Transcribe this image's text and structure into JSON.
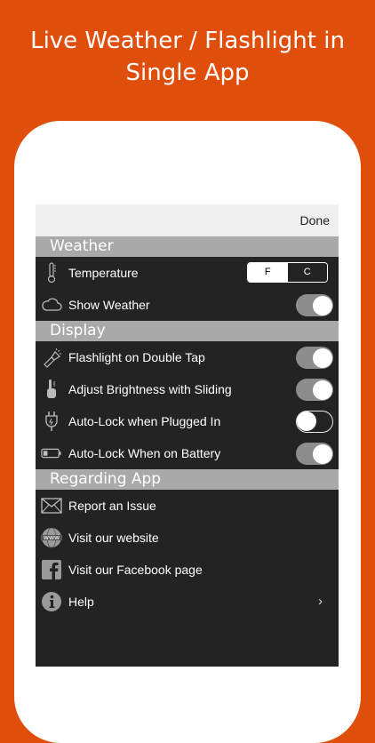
{
  "headline": {
    "line1": "Live Weather / Flashlight in",
    "line2": "Single App"
  },
  "navbar": {
    "done_label": "Done"
  },
  "sections": {
    "weather": {
      "title": "Weather",
      "temperature_label": "Temperature",
      "unit_options": [
        "F",
        "C"
      ],
      "selected_unit": "F",
      "show_weather_label": "Show Weather",
      "show_weather_on": true
    },
    "display": {
      "title": "Display",
      "items": [
        {
          "label": "Flashlight on Double Tap",
          "on": true,
          "icon": "flashlight-icon"
        },
        {
          "label": "Adjust Brightness with Sliding",
          "on": true,
          "icon": "finger-slide-icon"
        },
        {
          "label": "Auto-Lock when Plugged In",
          "on": false,
          "icon": "plug-icon"
        },
        {
          "label": "Auto-Lock When on Battery",
          "on": true,
          "icon": "battery-icon"
        }
      ]
    },
    "regarding": {
      "title": "Regarding App",
      "items": [
        {
          "label": "Report an Issue",
          "icon": "envelope-icon"
        },
        {
          "label": "Visit our website",
          "icon": "globe-www-icon"
        },
        {
          "label": "Visit our Facebook page",
          "icon": "facebook-icon"
        },
        {
          "label": "Help",
          "icon": "info-icon"
        }
      ]
    }
  },
  "colors": {
    "background": "#e04e0c",
    "panel": "#232323",
    "section_header": "#a9a9a9",
    "toggle_on": "#8d8d8d"
  }
}
